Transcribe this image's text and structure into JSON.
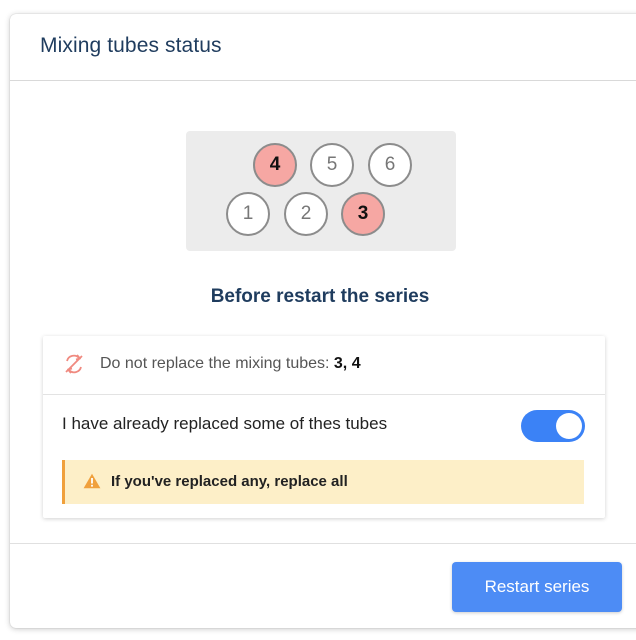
{
  "dialog": {
    "title": "Mixing tubes status"
  },
  "tubes": [
    {
      "label": "4",
      "flagged": true
    },
    {
      "label": "5",
      "flagged": false
    },
    {
      "label": "6",
      "flagged": false
    },
    {
      "label": "1",
      "flagged": false
    },
    {
      "label": "2",
      "flagged": false
    },
    {
      "label": "3",
      "flagged": true
    }
  ],
  "subtitle": "Before restart the series",
  "notice": {
    "icon": "no-replace-icon",
    "text": "Do not replace the mixing tubes: ",
    "tubes": "3, 4"
  },
  "toggle": {
    "label": "I have already replaced some of thes tubes",
    "checked": true
  },
  "warning": {
    "icon": "warning-triangle-icon",
    "text": "If you've replaced any, replace all"
  },
  "footer": {
    "restart_label": "Restart series"
  },
  "colors": {
    "accent": "#4d8cf5",
    "flagged_tube": "#f6a7a3",
    "warning_bg": "#fdefc8",
    "warning_border": "#f0a03c",
    "title": "#1f3c5e"
  }
}
